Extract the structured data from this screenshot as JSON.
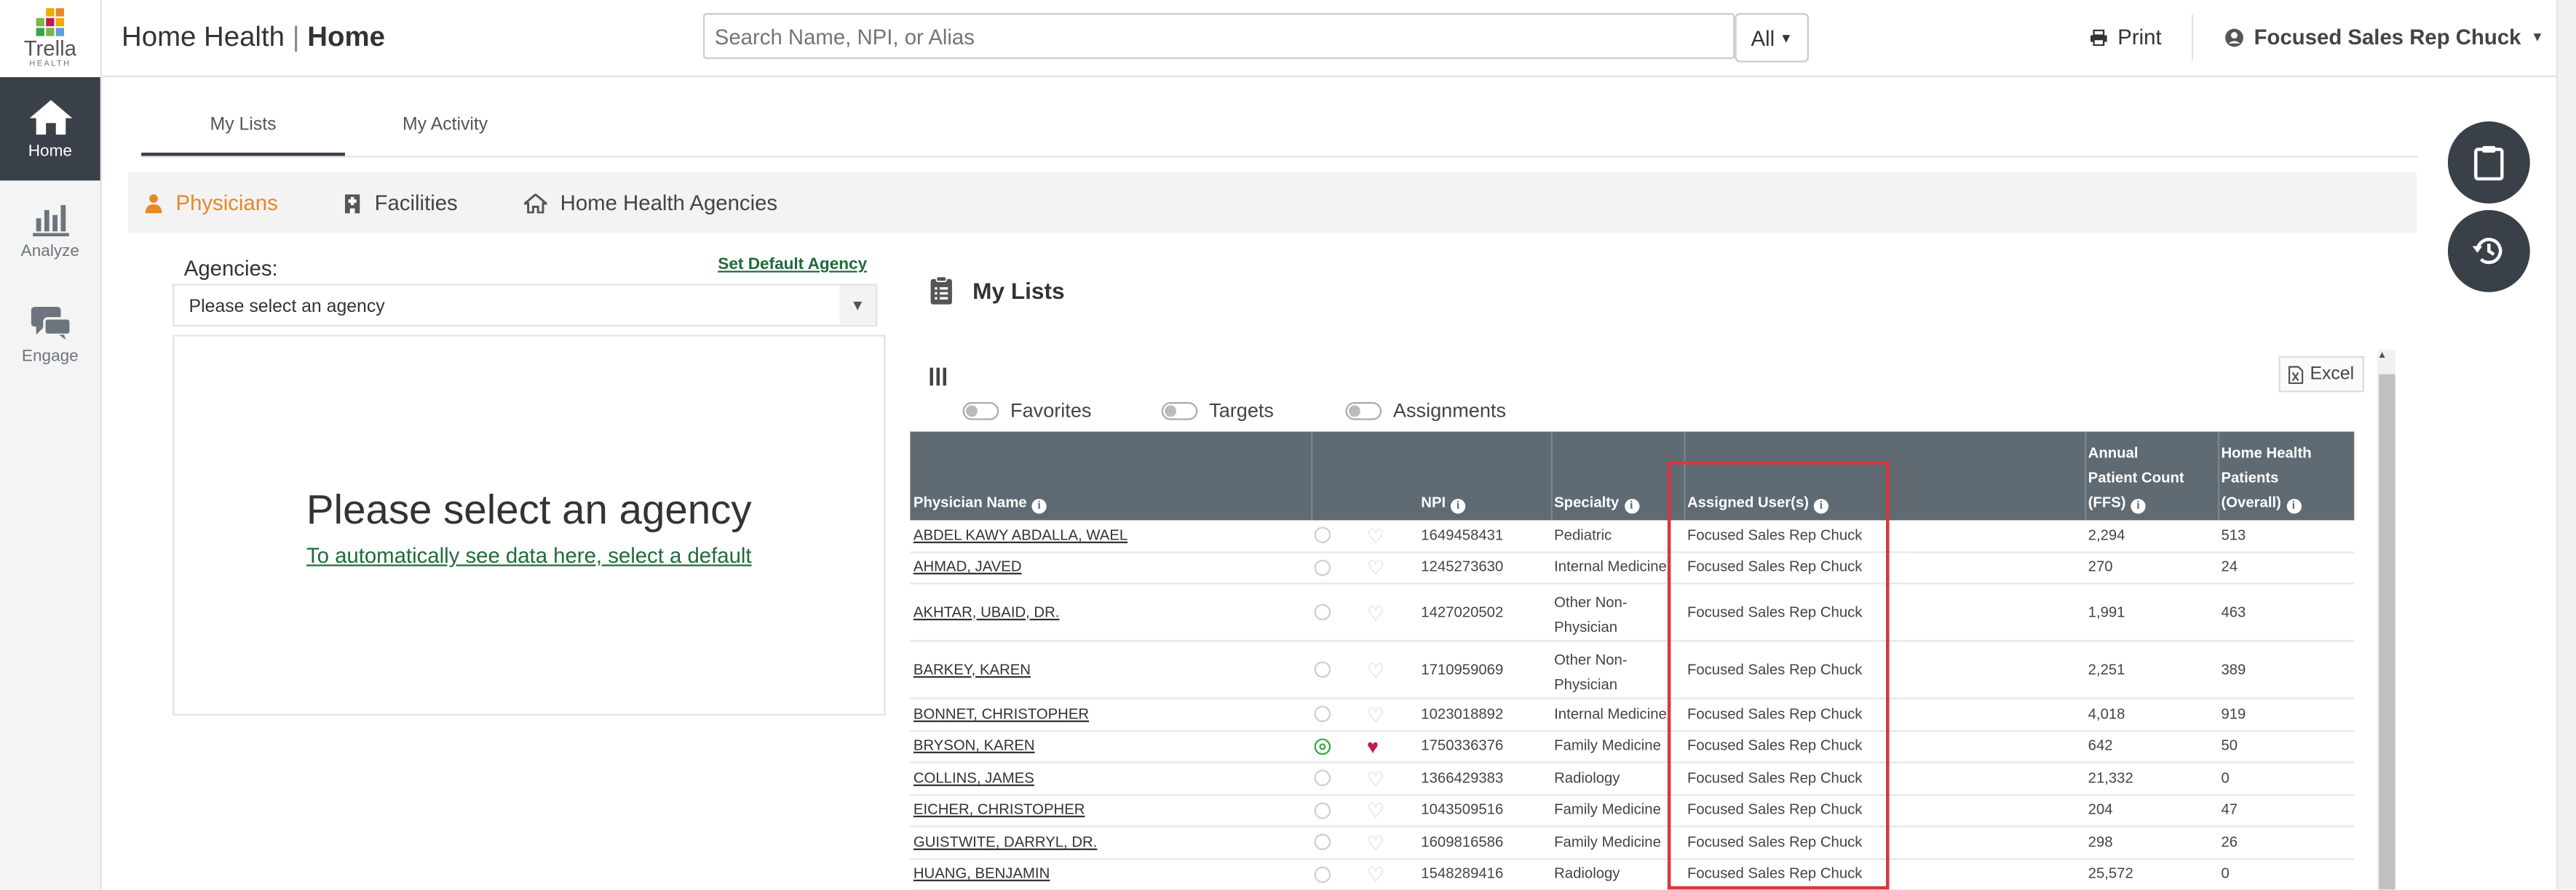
{
  "brand": {
    "logo_word": "Trella",
    "logo_sub": "HEALTH"
  },
  "rail": [
    {
      "label": "Home",
      "icon": "home-icon",
      "active": true
    },
    {
      "label": "Analyze",
      "icon": "bar-chart-icon",
      "active": false
    },
    {
      "label": "Engage",
      "icon": "chat-icon",
      "active": false
    }
  ],
  "header": {
    "product": "Home Health",
    "separator": "|",
    "page": "Home",
    "search_placeholder": "Search Name, NPI, or Alias",
    "search_scope": "All",
    "print_label": "Print",
    "user_label": "Focused Sales Rep Chuck"
  },
  "tabs": {
    "my_lists": "My Lists",
    "my_activity": "My Activity"
  },
  "entities": {
    "physicians": "Physicians",
    "facilities": "Facilities",
    "agencies": "Home Health Agencies"
  },
  "agency_panel": {
    "label": "Agencies:",
    "set_default": "Set Default Agency",
    "select_value": "Please select an agency",
    "empty_title": "Please select an agency",
    "empty_link": "To automatically see data here, select a default"
  },
  "lists": {
    "title": "My Lists",
    "excel_label": "Excel",
    "toggles": {
      "favorites": "Favorites",
      "targets": "Targets",
      "assignments": "Assignments"
    },
    "columns": {
      "name": "Physician Name",
      "npi": "NPI",
      "specialty": "Specialty",
      "assigned": "Assigned User(s)",
      "apc_1": "Annual",
      "apc_2": "Patient Count",
      "apc_3": "(FFS)",
      "hhp_1": "Home Health",
      "hhp_2": "Patients",
      "hhp_3": "(Overall)"
    },
    "rows": [
      {
        "name": "ABDEL KAWY ABDALLA, WAEL",
        "target": false,
        "fav": false,
        "npi": "1649458431",
        "spec1": "Pediatric",
        "spec2": "",
        "assigned": "Focused Sales Rep Chuck",
        "apc": "2,294",
        "hhp": "513"
      },
      {
        "name": "AHMAD, JAVED",
        "target": false,
        "fav": false,
        "npi": "1245273630",
        "spec1": "Internal Medicine",
        "spec2": "",
        "assigned": "Focused Sales Rep Chuck",
        "apc": "270",
        "hhp": "24"
      },
      {
        "name": "AKHTAR, UBAID, DR.",
        "target": false,
        "fav": false,
        "npi": "1427020502",
        "spec1": "Other Non-",
        "spec2": "Physician",
        "assigned": "Focused Sales Rep Chuck",
        "apc": "1,991",
        "hhp": "463"
      },
      {
        "name": "BARKEY, KAREN",
        "target": false,
        "fav": false,
        "npi": "1710959069",
        "spec1": "Other Non-",
        "spec2": "Physician",
        "assigned": "Focused Sales Rep Chuck",
        "apc": "2,251",
        "hhp": "389"
      },
      {
        "name": "BONNET, CHRISTOPHER",
        "target": false,
        "fav": false,
        "npi": "1023018892",
        "spec1": "Internal Medicine",
        "spec2": "",
        "assigned": "Focused Sales Rep Chuck",
        "apc": "4,018",
        "hhp": "919"
      },
      {
        "name": "BRYSON, KAREN",
        "target": true,
        "fav": true,
        "npi": "1750336376",
        "spec1": "Family Medicine",
        "spec2": "",
        "assigned": "Focused Sales Rep Chuck",
        "apc": "642",
        "hhp": "50"
      },
      {
        "name": "COLLINS, JAMES",
        "target": false,
        "fav": false,
        "npi": "1366429383",
        "spec1": "Radiology",
        "spec2": "",
        "assigned": "Focused Sales Rep Chuck",
        "apc": "21,332",
        "hhp": "0"
      },
      {
        "name": "EICHER, CHRISTOPHER",
        "target": false,
        "fav": false,
        "npi": "1043509516",
        "spec1": "Family Medicine",
        "spec2": "",
        "assigned": "Focused Sales Rep Chuck",
        "apc": "204",
        "hhp": "47"
      },
      {
        "name": "GUISTWITE, DARRYL, DR.",
        "target": false,
        "fav": false,
        "npi": "1609816586",
        "spec1": "Family Medicine",
        "spec2": "",
        "assigned": "Focused Sales Rep Chuck",
        "apc": "298",
        "hhp": "26"
      },
      {
        "name": "HUANG, BENJAMIN",
        "target": false,
        "fav": false,
        "npi": "1548289416",
        "spec1": "Radiology",
        "spec2": "",
        "assigned": "Focused Sales Rep Chuck",
        "apc": "25,572",
        "hhp": "0"
      }
    ]
  },
  "colors": {
    "accent": "#e8862a",
    "rail_active": "#3a4047",
    "header_bg": "#5f6a72",
    "link_green": "#1f6b3a",
    "highlight": "#d9363e"
  }
}
